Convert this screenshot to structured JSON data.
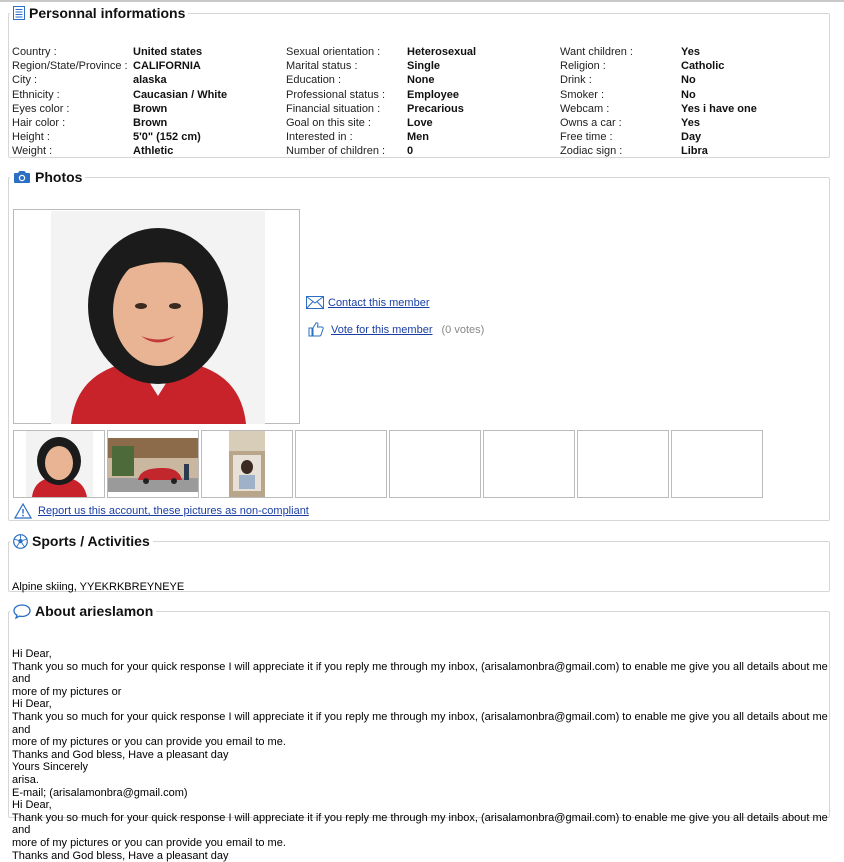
{
  "personal": {
    "title": "Personnal informations",
    "col1": [
      {
        "label": "Country :",
        "value": "United states"
      },
      {
        "label": "Region/State/Province :",
        "value": "CALIFORNIA"
      },
      {
        "label": "City :",
        "value": "alaska"
      },
      {
        "label": "Ethnicity :",
        "value": "Caucasian / White"
      },
      {
        "label": "Eyes color :",
        "value": "Brown"
      },
      {
        "label": "Hair color :",
        "value": "Brown"
      },
      {
        "label": "Height :",
        "value": "5'0\" (152 cm)"
      },
      {
        "label": "Weight :",
        "value": "Athletic"
      }
    ],
    "col2": [
      {
        "label": "Sexual orientation :",
        "value": "Heterosexual"
      },
      {
        "label": "Marital status :",
        "value": "Single"
      },
      {
        "label": "Education :",
        "value": "None"
      },
      {
        "label": "Professional status :",
        "value": "Employee"
      },
      {
        "label": "Financial situation :",
        "value": "Precarious"
      },
      {
        "label": "Goal on this site :",
        "value": "Love"
      },
      {
        "label": "Interested in :",
        "value": "Men"
      },
      {
        "label": "Number of children :",
        "value": "0"
      }
    ],
    "col3": [
      {
        "label": "Want children :",
        "value": "Yes"
      },
      {
        "label": "Religion :",
        "value": "Catholic"
      },
      {
        "label": "Drink :",
        "value": "No"
      },
      {
        "label": "Smoker :",
        "value": "No"
      },
      {
        "label": "Webcam :",
        "value": "Yes i have one"
      },
      {
        "label": "Owns a car :",
        "value": "Yes"
      },
      {
        "label": "Free time :",
        "value": "Day"
      },
      {
        "label": "Zodiac sign :",
        "value": "Libra"
      }
    ]
  },
  "photos": {
    "title": "Photos",
    "contact_label": "Contact this member",
    "vote_label": "Vote for this member",
    "vote_count": "(0 votes)",
    "report_label": "Report us this account, these pictures as non-compliant"
  },
  "sports": {
    "title": "Sports / Activities",
    "text": "Alpine skiing, YYEKRKBREYNEYE"
  },
  "about": {
    "title": "About arieslamon",
    "text": "Hi Dear,\nThank you so much for your quick response I will appreciate it if you reply me through my inbox, (arisalamonbra@gmail.com) to enable me give you all details about me and\nmore of my pictures or\nHi Dear,\nThank you so much for your quick response I will appreciate it if you reply me through my inbox, (arisalamonbra@gmail.com) to enable me give you all details about me and\nmore of my pictures or you can provide you email to me.\nThanks and God bless, Have a pleasant day\nYours Sincerely\narisa.\nE-mail; (arisalamonbra@gmail.com)\nHi Dear,\nThank you so much for your quick response I will appreciate it if you reply me through my inbox, (arisalamonbra@gmail.com) to enable me give you all details about me and\nmore of my pictures or you can provide you email to me.\nThanks and God bless, Have a pleasant day"
  },
  "colors": {
    "link": "#1a3ea6",
    "icon_blue": "#2a6fc4",
    "border": "#d6d6d6"
  }
}
